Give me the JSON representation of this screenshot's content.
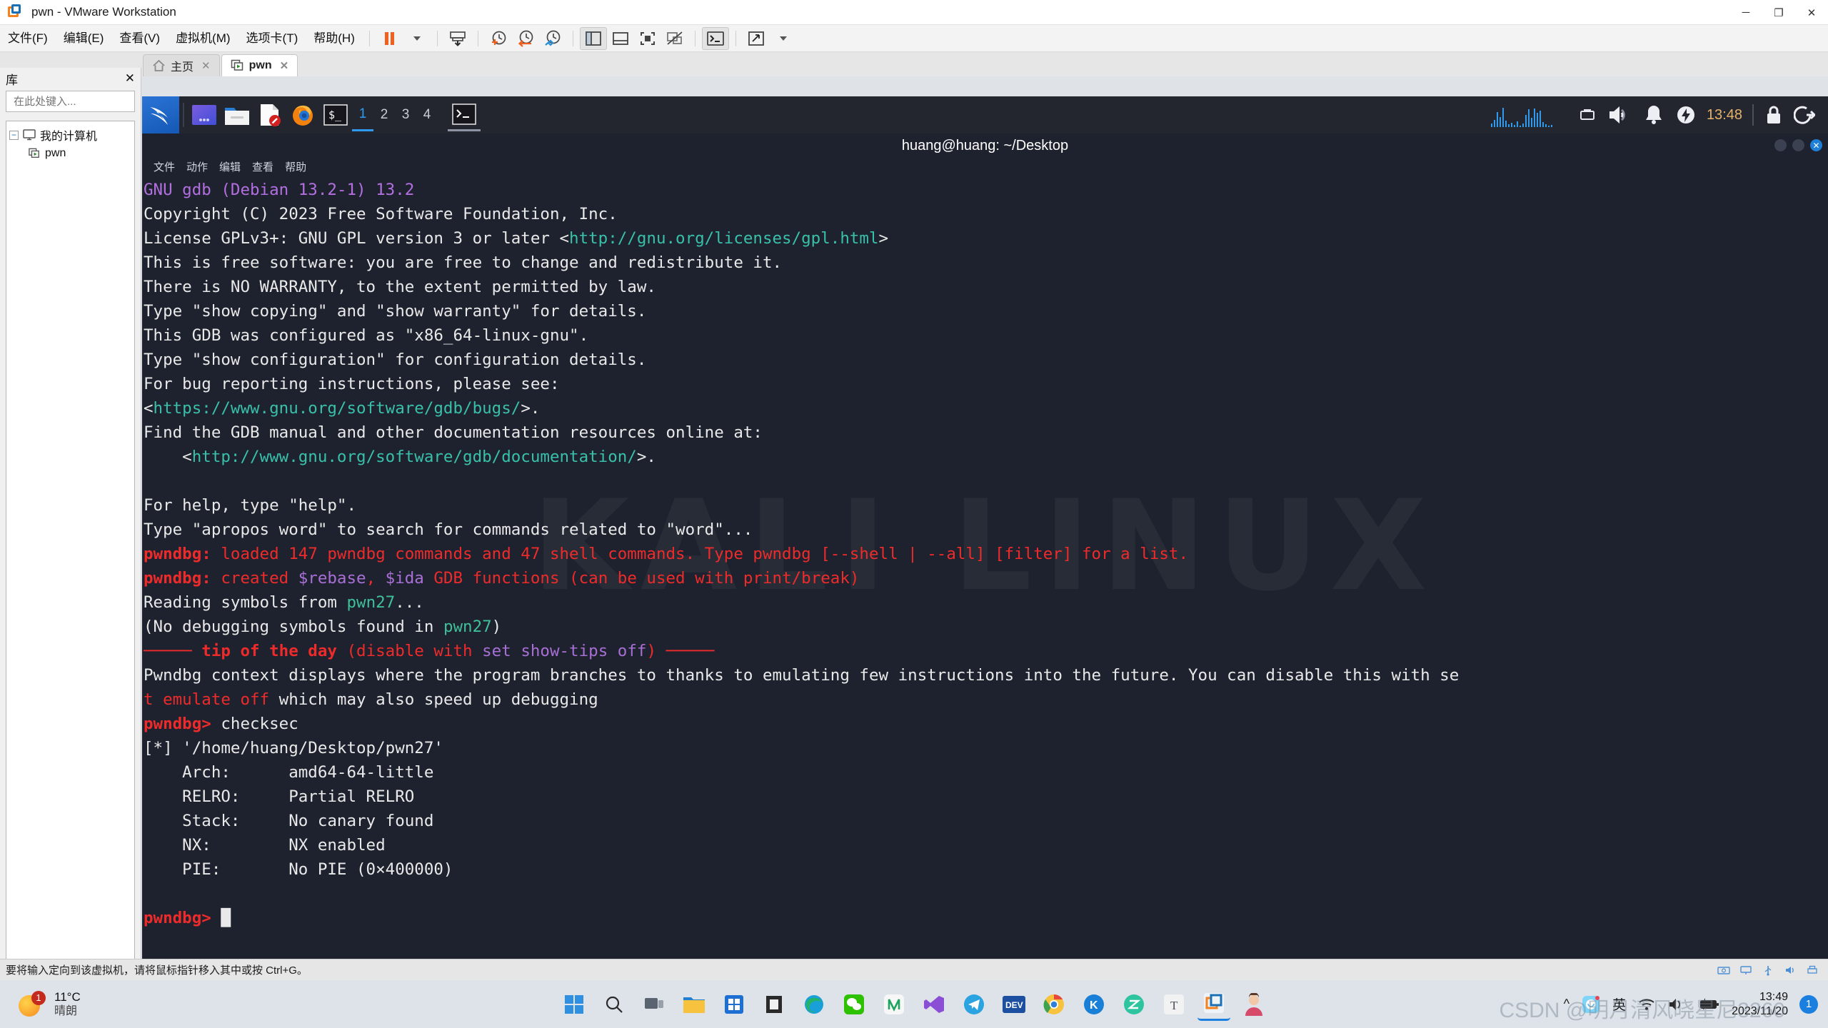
{
  "window": {
    "title": "pwn - VMware Workstation",
    "minimize_label": "─",
    "maximize_label": "❐",
    "close_label": "✕"
  },
  "menubar": {
    "items": [
      {
        "label": "文件(F)",
        "name": "menu-file"
      },
      {
        "label": "编辑(E)",
        "name": "menu-edit"
      },
      {
        "label": "查看(V)",
        "name": "menu-view"
      },
      {
        "label": "虚拟机(M)",
        "name": "menu-vm"
      },
      {
        "label": "选项卡(T)",
        "name": "menu-tabs"
      },
      {
        "label": "帮助(H)",
        "name": "menu-help"
      }
    ]
  },
  "toolbar": {
    "buttons": [
      {
        "name": "suspend-button",
        "icon": "pause-icon"
      },
      {
        "name": "power-dropdown",
        "icon": "chevron-down-icon"
      },
      {
        "name": "send-ctrl-alt-del-button",
        "icon": "snapshot-save-icon"
      },
      {
        "name": "take-snapshot-button",
        "icon": "snapshot-add-icon"
      },
      {
        "name": "revert-snapshot-button",
        "icon": "snapshot-revert-icon"
      },
      {
        "name": "snapshot-manager-button",
        "icon": "snapshot-manage-icon"
      },
      {
        "name": "show-library-button",
        "icon": "library-panel-icon"
      },
      {
        "name": "show-thumbnail-bar-button",
        "icon": "thumbnail-bar-icon"
      },
      {
        "name": "enter-fullscreen-button",
        "icon": "fullscreen-icon"
      },
      {
        "name": "unity-mode-button",
        "icon": "unity-icon"
      },
      {
        "name": "console-view-button",
        "icon": "terminal-icon"
      },
      {
        "name": "stretch-guest-button",
        "icon": "stretch-icon"
      },
      {
        "name": "view-dropdown",
        "icon": "chevron-down-icon"
      }
    ]
  },
  "tabs": [
    {
      "label": "主页",
      "name": "tab-home",
      "icon": "home-icon",
      "active": false,
      "closable": true
    },
    {
      "label": "pwn",
      "name": "tab-pwn",
      "icon": "vm-icon",
      "active": true,
      "closable": true
    }
  ],
  "library": {
    "title": "库",
    "close_label": "✕",
    "search_placeholder": "在此处键入...",
    "search_value": "",
    "search_icon": "search-icon",
    "dropdown_icon": "chevron-down-icon",
    "tree": [
      {
        "label": "我的计算机",
        "name": "tree-item-my-computer",
        "expander": "−",
        "icon": "computer-icon"
      },
      {
        "label": "pwn",
        "name": "tree-item-pwn",
        "icon": "vm-icon"
      }
    ]
  },
  "kali": {
    "panel": {
      "kali_menu_icon": "kali-dragon-icon",
      "apps": [
        {
          "name": "taskbar-app-terminal-emulator",
          "icon": "purple-app-icon"
        },
        {
          "name": "taskbar-app-file-manager",
          "icon": "folder-icon"
        },
        {
          "name": "taskbar-app-text-editor",
          "icon": "document-edit-icon"
        },
        {
          "name": "taskbar-app-firefox",
          "icon": "firefox-icon"
        },
        {
          "name": "taskbar-app-terminal",
          "icon": "terminal-prompt-icon"
        }
      ],
      "workspaces": [
        "1",
        "2",
        "3",
        "4"
      ],
      "active_workspace": "1",
      "open_window_icon": "terminal-window-icon",
      "tray": {
        "cpu_graph": "cpu-graph-icon",
        "network": "network-icon",
        "volume": "volume-icon",
        "notifications": "bell-icon",
        "power": "power-bolt-icon",
        "clock": "13:48",
        "lock": "lock-icon",
        "logout": "logout-icon"
      }
    },
    "terminal": {
      "title": "huang@huang: ~/Desktop",
      "menu": [
        "文件",
        "动作",
        "编辑",
        "查看",
        "帮助"
      ],
      "window_buttons": [
        "minimize",
        "maximize",
        "close"
      ],
      "wallpaper_text": "KALI LINUX",
      "lines": [
        [
          {
            "t": "GNU gdb (Debian 13.2-1) 13.2",
            "c": "c-magenta"
          }
        ],
        [
          {
            "t": "Copyright (C) 2023 Free Software Foundation, Inc.",
            "c": "c-white"
          }
        ],
        [
          {
            "t": "License GPLv3+: GNU GPL version 3 or later <",
            "c": "c-white"
          },
          {
            "t": "http://gnu.org/licenses/gpl.html",
            "c": "c-cyan"
          },
          {
            "t": ">",
            "c": "c-white"
          }
        ],
        [
          {
            "t": "This is free software: you are free to change and redistribute it.",
            "c": "c-white"
          }
        ],
        [
          {
            "t": "There is NO WARRANTY, to the extent permitted by law.",
            "c": "c-white"
          }
        ],
        [
          {
            "t": "Type \"show copying\" and \"show warranty\" for details.",
            "c": "c-white"
          }
        ],
        [
          {
            "t": "This GDB was configured as \"x86_64-linux-gnu\".",
            "c": "c-white"
          }
        ],
        [
          {
            "t": "Type \"show configuration\" for configuration details.",
            "c": "c-white"
          }
        ],
        [
          {
            "t": "For bug reporting instructions, please see:",
            "c": "c-white"
          }
        ],
        [
          {
            "t": "<",
            "c": "c-white"
          },
          {
            "t": "https://www.gnu.org/software/gdb/bugs/",
            "c": "c-cyan"
          },
          {
            "t": ">.",
            "c": "c-white"
          }
        ],
        [
          {
            "t": "Find the GDB manual and other documentation resources online at:",
            "c": "c-white"
          }
        ],
        [
          {
            "t": "    <",
            "c": "c-white"
          },
          {
            "t": "http://www.gnu.org/software/gdb/documentation/",
            "c": "c-cyan"
          },
          {
            "t": ">.",
            "c": "c-white"
          }
        ],
        [
          {
            "t": "",
            "c": "c-white"
          }
        ],
        [
          {
            "t": "For help, type \"help\".",
            "c": "c-white"
          }
        ],
        [
          {
            "t": "Type \"apropos word\" to search for commands related to \"word\"...",
            "c": "c-white"
          }
        ],
        [
          {
            "t": "pwndbg:",
            "c": "c-redb"
          },
          {
            "t": " loaded 147 pwndbg commands and 47 shell commands. Type ",
            "c": "c-red"
          },
          {
            "t": "pwndbg",
            "c": "c-red"
          },
          {
            "t": " [--shell | --all] [filter] for a list.",
            "c": "c-red"
          }
        ],
        [
          {
            "t": "pwndbg:",
            "c": "c-redb"
          },
          {
            "t": " created ",
            "c": "c-red"
          },
          {
            "t": "$rebase",
            "c": "c-purple"
          },
          {
            "t": ", ",
            "c": "c-red"
          },
          {
            "t": "$ida",
            "c": "c-purple"
          },
          {
            "t": " GDB functions (can be used with print/break)",
            "c": "c-red"
          }
        ],
        [
          {
            "t": "Reading symbols from ",
            "c": "c-white"
          },
          {
            "t": "pwn27",
            "c": "c-green"
          },
          {
            "t": "...",
            "c": "c-white"
          }
        ],
        [
          {
            "t": "(No debugging symbols found in ",
            "c": "c-white"
          },
          {
            "t": "pwn27",
            "c": "c-green"
          },
          {
            "t": ")",
            "c": "c-white"
          }
        ],
        [
          {
            "t": "───── ",
            "c": "c-red"
          },
          {
            "t": "tip of the day",
            "c": "c-redb"
          },
          {
            "t": " (disable with ",
            "c": "c-red"
          },
          {
            "t": "set show-tips off",
            "c": "c-purple"
          },
          {
            "t": ") ─────",
            "c": "c-red"
          }
        ],
        [
          {
            "t": "Pwndbg context displays where the program branches to thanks to emulating few instructions into the future. You can disable this with se",
            "c": "c-white"
          }
        ],
        [
          {
            "t": "t emulate off",
            "c": "c-red"
          },
          {
            "t": " which may also speed up debugging",
            "c": "c-white"
          }
        ],
        [
          {
            "t": "pwndbg>",
            "c": "c-redb"
          },
          {
            "t": " checksec",
            "c": "c-white"
          }
        ],
        [
          {
            "t": "[*] '/home/huang/Desktop/pwn27'",
            "c": "c-white"
          }
        ],
        [
          {
            "t": "    Arch:      amd64-64-little",
            "c": "c-white"
          }
        ],
        [
          {
            "t": "    RELRO:     Partial RELRO",
            "c": "c-white"
          }
        ],
        [
          {
            "t": "    Stack:     No canary found",
            "c": "c-white"
          }
        ],
        [
          {
            "t": "    NX:        NX enabled",
            "c": "c-white"
          }
        ],
        [
          {
            "t": "    PIE:       No PIE (0×400000)",
            "c": "c-white"
          }
        ],
        [
          {
            "t": "",
            "c": "c-white"
          }
        ],
        [
          {
            "t": "pwndbg>",
            "c": "c-redb"
          },
          {
            "t": " ",
            "c": "c-white"
          },
          {
            "t": "█",
            "c": "c-white"
          }
        ]
      ]
    }
  },
  "vm_status": {
    "message": "要将输入定向到该虚拟机，请将鼠标指针移入其中或按 Ctrl+G。",
    "icons": [
      "hard-disk-icon",
      "network-icon",
      "usb-icon",
      "sound-icon",
      "printer-icon"
    ]
  },
  "windows_taskbar": {
    "weather": {
      "temperature": "11°C",
      "condition": "晴朗",
      "badge": "1"
    },
    "apps": [
      {
        "name": "start-button",
        "icon": "windows-logo-icon"
      },
      {
        "name": "search-button",
        "icon": "search-icon"
      },
      {
        "name": "task-view-button",
        "icon": "task-view-icon"
      },
      {
        "name": "file-explorer-button",
        "icon": "folder-icon"
      },
      {
        "name": "microsoft-store-button",
        "icon": "store-icon"
      },
      {
        "name": "winrar-button",
        "icon": "winrar-icon"
      },
      {
        "name": "edge-button",
        "icon": "edge-icon"
      },
      {
        "name": "wechat-button",
        "icon": "wechat-icon"
      },
      {
        "name": "navicat-button",
        "icon": "navicat-icon"
      },
      {
        "name": "visual-studio-button",
        "icon": "visual-studio-icon"
      },
      {
        "name": "telegram-button",
        "icon": "telegram-icon"
      },
      {
        "name": "dev-cpp-button",
        "icon": "devcpp-icon"
      },
      {
        "name": "chrome-button",
        "icon": "chrome-icon"
      },
      {
        "name": "kugou-button",
        "icon": "kugou-icon"
      },
      {
        "name": "zeal-button",
        "icon": "zeal-icon"
      },
      {
        "name": "typora-button",
        "icon": "typora-icon"
      },
      {
        "name": "vmware-button",
        "icon": "vmware-icon"
      },
      {
        "name": "avatar-button",
        "icon": "avatar-icon"
      }
    ],
    "tray": {
      "overflow": "^",
      "ime_app": "ime-icon",
      "language": "英",
      "wifi": "wifi-icon",
      "volume": "volume-icon",
      "battery": "battery-charging-icon",
      "time": "13:49",
      "date": "2023/11/20",
      "notifications": "1"
    }
  },
  "watermark": "CSDN @明月清风晓星尼3260"
}
